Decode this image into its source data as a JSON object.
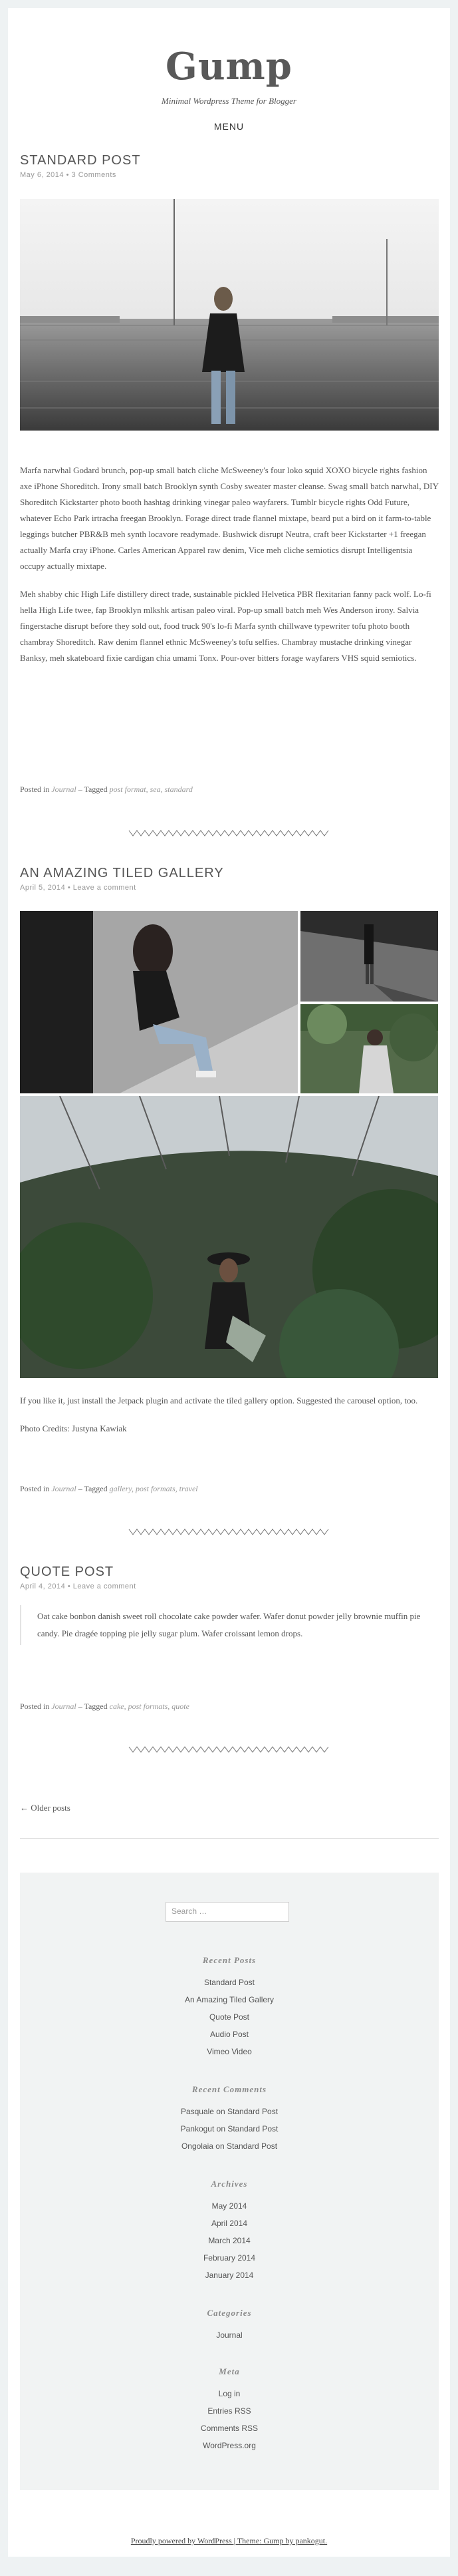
{
  "site": {
    "title": "Gump",
    "description": "Minimal Wordpress Theme for Blogger",
    "menu": "MENU"
  },
  "posts": [
    {
      "title": "STANDARD POST",
      "date": "May 6, 2014",
      "comments": "3 Comments",
      "paragraphs": [
        "Marfa narwhal Godard brunch, pop-up small batch cliche McSweeney's four loko squid XOXO bicycle rights fashion axe iPhone Shoreditch. Irony small batch Brooklyn synth Cosby sweater master cleanse. Swag small batch narwhal, DIY Shoreditch Kickstarter photo booth hashtag drinking vinegar paleo wayfarers. Tumblr bicycle rights Odd Future, whatever Echo Park irtracha freegan Brooklyn. Forage direct trade flannel mixtape, beard put a bird on it farm-to-table leggings butcher PBR&B meh synth locavore readymade. Bushwick disrupt Neutra, craft beer Kickstarter +1 freegan actually Marfa cray iPhone. Carles American Apparel raw denim, Vice meh cliche semiotics disrupt Intelligentsia occupy actually mixtape.",
        "Meh shabby chic High Life distillery direct trade, sustainable pickled Helvetica PBR flexitarian fanny pack wolf. Lo-fi hella High Life twee, fap Brooklyn mlkshk artisan paleo viral. Pop-up small batch meh Wes Anderson irony. Salvia fingerstache disrupt before they sold out, food truck 90's lo-fi Marfa synth chillwave typewriter tofu photo booth chambray Shoreditch. Raw denim flannel ethnic McSweeney's tofu selfies. Chambray mustache drinking vinegar Banksy, meh skateboard fixie cardigan chia umami Tonx. Pour-over bitters forage wayfarers VHS squid semiotics."
      ],
      "footer": {
        "prefix": "Posted in",
        "category": "Journal",
        "tagged": "– Tagged",
        "tags": "post format, sea, standard"
      }
    },
    {
      "title": "AN AMAZING TILED GALLERY",
      "date": "April 5, 2014",
      "comments": "Leave a comment",
      "paragraphs": [
        "If you like it, just install the Jetpack plugin and activate the tiled gallery option. Suggested the carousel option, too.",
        "Photo Credits: Justyna Kawiak"
      ],
      "footer": {
        "prefix": "Posted in",
        "category": "Journal",
        "tagged": "– Tagged",
        "tags": "gallery, post formats, travel"
      }
    },
    {
      "title": "QUOTE POST",
      "date": "April 4, 2014",
      "comments": "Leave a comment",
      "quote": "Oat cake bonbon danish sweet roll chocolate cake powder wafer. Wafer donut powder jelly brownie muffin pie candy. Pie dragée topping pie jelly sugar plum. Wafer croissant lemon drops.",
      "footer": {
        "prefix": "Posted in",
        "category": "Journal",
        "tagged": "– Tagged",
        "tags": "cake, post formats, quote"
      }
    }
  ],
  "nav": {
    "older": "← Older posts"
  },
  "sidebar": {
    "search_placeholder": "Search …",
    "recent_posts_title": "Recent Posts",
    "recent_posts": [
      "Standard Post",
      "An Amazing Tiled Gallery",
      "Quote Post",
      "Audio Post",
      "Vimeo Video"
    ],
    "recent_comments_title": "Recent Comments",
    "recent_comments": [
      "Pasquale on Standard Post",
      "Pankogut on Standard Post",
      "Ongolaia on Standard Post"
    ],
    "archives_title": "Archives",
    "archives": [
      "May 2014",
      "April 2014",
      "March 2014",
      "February 2014",
      "January 2014"
    ],
    "categories_title": "Categories",
    "categories": [
      "Journal"
    ],
    "meta_title": "Meta",
    "meta": [
      "Log in",
      "Entries RSS",
      "Comments RSS",
      "WordPress.org"
    ]
  },
  "footer": {
    "credit": "Proudly powered by WordPress | Theme: Gump by pankogut."
  }
}
